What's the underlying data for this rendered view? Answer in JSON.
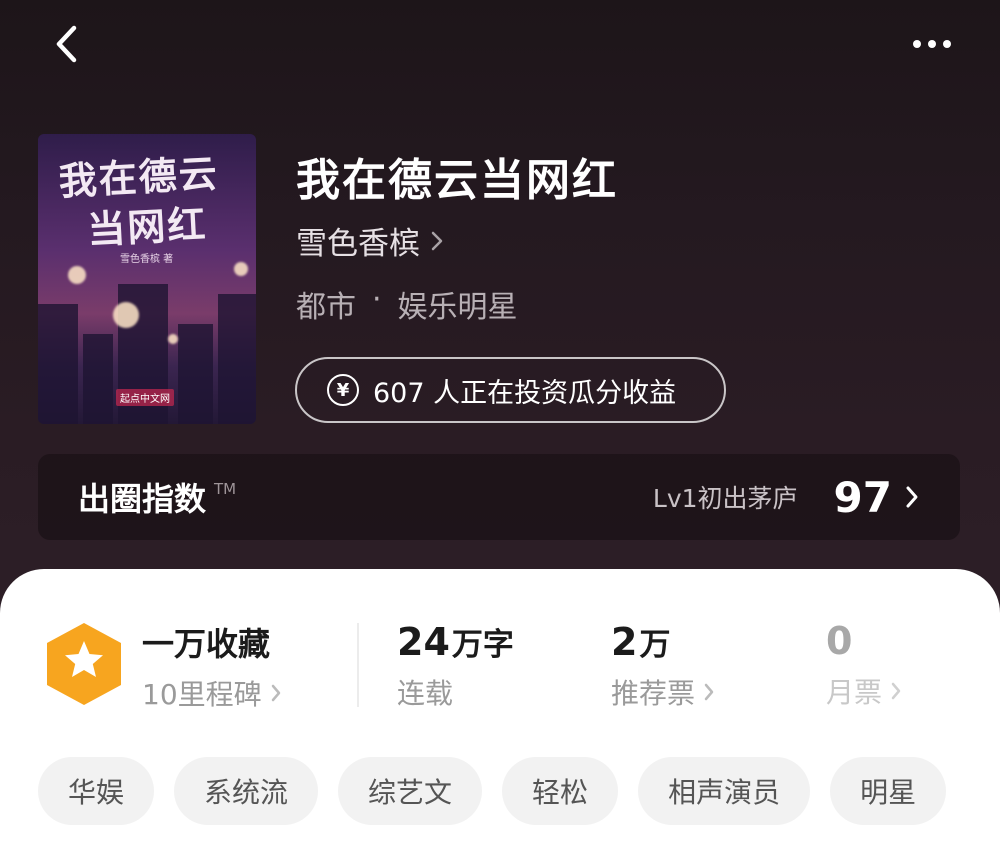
{
  "book": {
    "title": "我在德云当网红",
    "author": "雪色香槟",
    "category": "都市",
    "separator": "·",
    "subcategory": "娱乐明星",
    "cover": {
      "title_line1": "我在德云",
      "title_line2": "当网红",
      "author_text": "雪色香槟 著",
      "publisher": "起点中文网"
    }
  },
  "invest": {
    "icon": "yen-icon",
    "symbol": "¥",
    "text": "607 人正在投资瓜分收益"
  },
  "index": {
    "label": "出圈指数",
    "tm": "TM",
    "level": "Lv1初出茅庐",
    "score": "97"
  },
  "stats": {
    "collection": {
      "title": "一万收藏",
      "sub": "10里程碑"
    },
    "words": {
      "num": "24",
      "unit": "万字",
      "sub": "连载"
    },
    "recommend": {
      "num": "2",
      "unit": "万",
      "sub": "推荐票"
    },
    "monthly": {
      "num": "0",
      "sub": "月票"
    }
  },
  "tags": [
    "华娱",
    "系统流",
    "综艺文",
    "轻松",
    "相声演员",
    "明星"
  ],
  "colors": {
    "hero_bg": "#251a20",
    "badge_orange": "#f7a51f",
    "tag_bg": "#f2f2f2"
  }
}
